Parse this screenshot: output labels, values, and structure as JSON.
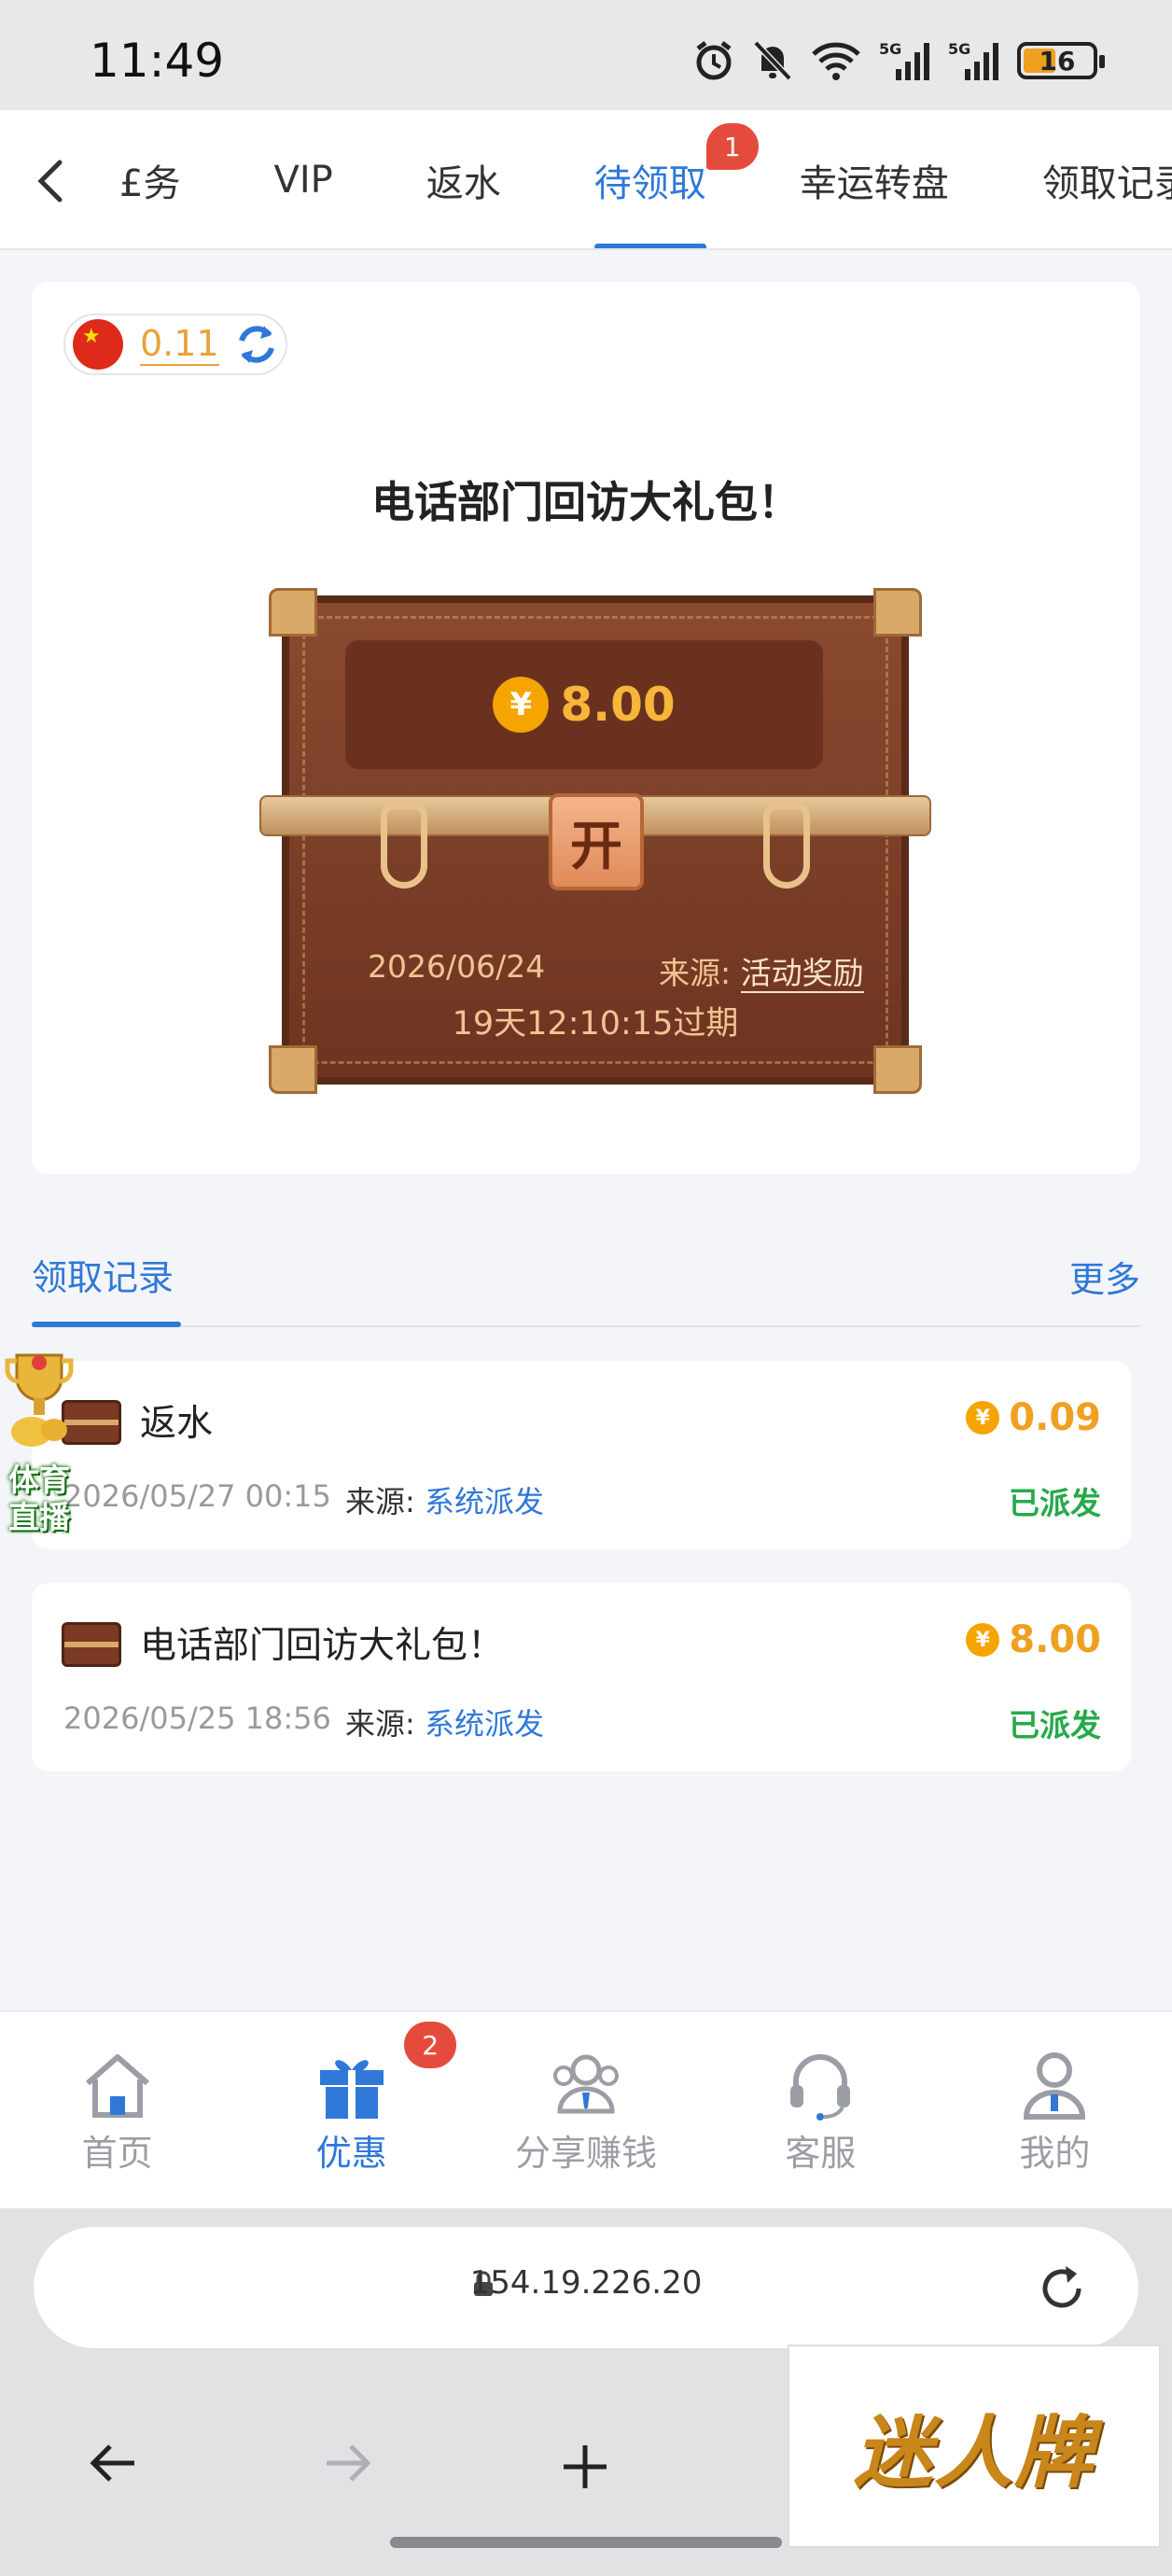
{
  "status_bar": {
    "time": "11:49",
    "battery": "16"
  },
  "tabs": {
    "items": [
      {
        "label": "任务",
        "display": "£务"
      },
      {
        "label": "VIP"
      },
      {
        "label": "返水"
      },
      {
        "label": "待领取",
        "badge": "1"
      },
      {
        "label": "幸运转盘"
      },
      {
        "label": "领取记录"
      }
    ]
  },
  "balance": {
    "value": "0.11"
  },
  "gift": {
    "title": "电话部门回访大礼包！",
    "amount": "8.00",
    "currency_symbol": "¥",
    "lock_label": "开",
    "date": "2026/06/24",
    "source_label": "来源:",
    "source_value": "活动奖励",
    "expire": "19天12:10:15过期"
  },
  "records": {
    "title": "领取记录",
    "more": "更多",
    "items": [
      {
        "title": "返水",
        "amount": "0.09",
        "date": "2026/05/27 00:15",
        "source_label": "来源:",
        "source_value": "系统派发",
        "status": "已派发"
      },
      {
        "title": "电话部门回访大礼包！",
        "amount": "8.00",
        "date": "2026/05/25 18:56",
        "source_label": "来源:",
        "source_value": "系统派发",
        "status": "已派发"
      }
    ]
  },
  "floating": {
    "line1": "体育",
    "line2": "直播"
  },
  "bottom_nav": {
    "items": [
      {
        "label": "首页",
        "icon": "home-icon"
      },
      {
        "label": "优惠",
        "icon": "gift-icon",
        "badge": "2",
        "active": true
      },
      {
        "label": "分享赚钱",
        "icon": "share-people-icon"
      },
      {
        "label": "客服",
        "icon": "headset-icon"
      },
      {
        "label": "我的",
        "icon": "user-icon"
      }
    ]
  },
  "browser": {
    "url": "154.19.226.20",
    "brand": "迷人牌"
  },
  "colors": {
    "accent": "#2f78d8",
    "gold": "#f0a020",
    "success": "#27a94a",
    "badge": "#e54b3c"
  }
}
